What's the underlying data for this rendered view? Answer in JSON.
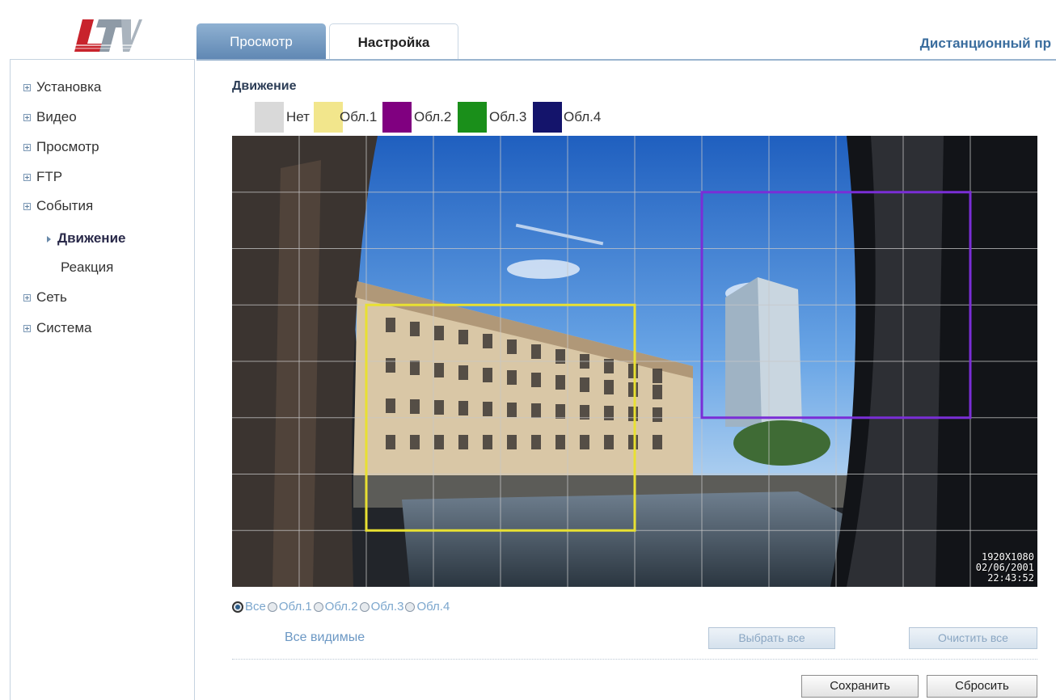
{
  "header": {
    "tabs": [
      {
        "label": "Просмотр",
        "active": false
      },
      {
        "label": "Настройка",
        "active": true
      }
    ],
    "title": "Дистанционный пр"
  },
  "sidebar": {
    "items": [
      {
        "label": "Установка"
      },
      {
        "label": "Видео"
      },
      {
        "label": "Просмотр"
      },
      {
        "label": "FTP"
      },
      {
        "label": "События"
      },
      {
        "label": "Сеть"
      },
      {
        "label": "Система"
      }
    ],
    "sub_items": [
      {
        "label": "Движение",
        "active": true
      },
      {
        "label": "Реакция",
        "active": false
      }
    ]
  },
  "main": {
    "section_title": "Движение",
    "legend": [
      {
        "label": "Нет",
        "color": "#d9d9d9"
      },
      {
        "label": "Обл.1",
        "color": "#f2e68c"
      },
      {
        "label": "Обл.2",
        "color": "#800080"
      },
      {
        "label": "Обл.3",
        "color": "#1a8f1a"
      },
      {
        "label": "Обл.4",
        "color": "#14146b"
      }
    ],
    "osd": {
      "resolution": "1920X1080",
      "date": "02/06/2001",
      "time": "22:43:52"
    },
    "zones": [
      {
        "name": "Обл.1",
        "color": "#e8e032"
      },
      {
        "name": "Обл.2",
        "color": "#7a2ed6"
      }
    ],
    "area_options": [
      {
        "label": "Все",
        "checked": true
      },
      {
        "label": "Обл.1",
        "checked": false
      },
      {
        "label": "Обл.2",
        "checked": false
      },
      {
        "label": "Обл.3",
        "checked": false
      },
      {
        "label": "Обл.4",
        "checked": false
      }
    ],
    "all_visible_label": "Все видимые",
    "select_all_label": "Выбрать все",
    "clear_all_label": "Очистить все",
    "save_label": "Сохранить",
    "reset_label": "Сбросить"
  }
}
